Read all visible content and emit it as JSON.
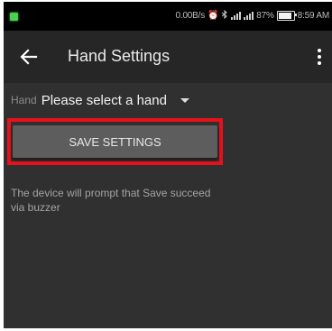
{
  "status_bar": {
    "network_speed": "0.00B/s",
    "icons": [
      "alarm-icon",
      "bluetooth-icon",
      "hd-signal-icon",
      "signal-icon"
    ],
    "battery_percent": "87%",
    "battery_level": 0.87,
    "time": "8:59 AM",
    "notification_color": "#47d14f"
  },
  "app_bar": {
    "title": "Hand Settings",
    "back_icon": "arrow-left-icon",
    "menu_icon": "more-vertical-icon"
  },
  "form": {
    "hand_label": "Hand",
    "hand_select_value": "Please select a hand",
    "save_button_label": "SAVE SETTINGS",
    "hint": "The device will prompt that Save succeed via buzzer"
  },
  "colors": {
    "background": "#303030",
    "app_bar": "#262626",
    "button": "#5d5d5d",
    "highlight": "#e8101a"
  }
}
